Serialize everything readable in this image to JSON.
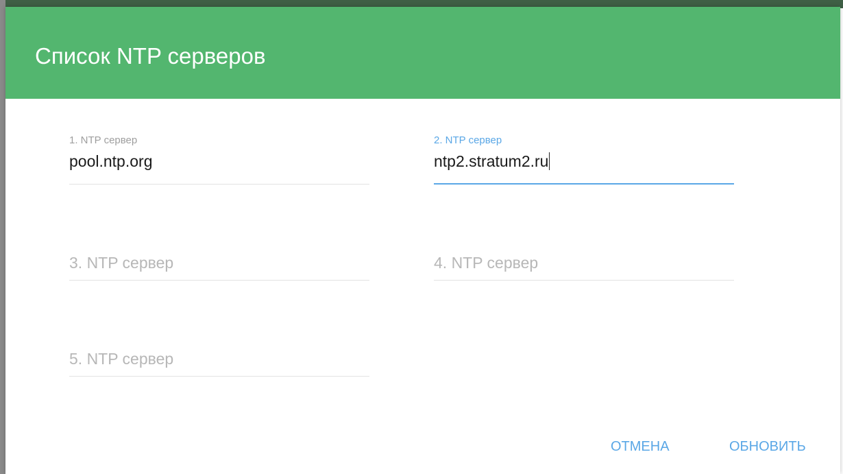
{
  "dialog": {
    "title": "Список NTP серверов",
    "header_color": "#53b66f",
    "accent_color": "#5aa7e6"
  },
  "fields": [
    {
      "label": "1. NTP сервер",
      "value": "pool.ntp.org"
    },
    {
      "label": "2. NTP сервер",
      "value": "ntp2.stratum2.ru",
      "focused": true
    },
    {
      "placeholder": "3. NTP сервер"
    },
    {
      "placeholder": "4. NTP сервер"
    },
    {
      "placeholder": "5. NTP сервер"
    }
  ],
  "actions": {
    "cancel_label": "ОТМЕНА",
    "update_label": "ОБНОВИТЬ"
  }
}
